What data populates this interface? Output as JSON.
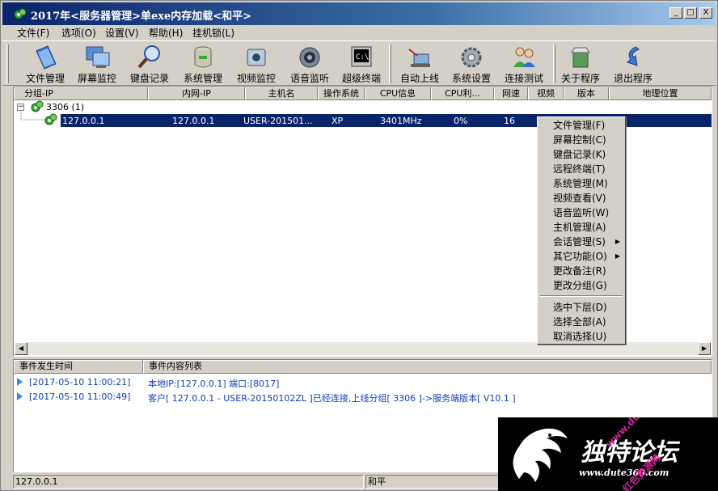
{
  "window": {
    "title": "2017年<服务器管理>单exe内存加载<和平>",
    "min_label": "_",
    "max_label": "□",
    "close_label": "X"
  },
  "menu": [
    {
      "label": "文件(F)"
    },
    {
      "label": "选项(O)"
    },
    {
      "label": "设置(V)"
    },
    {
      "label": "帮助(H)"
    },
    {
      "label": "挂机锁(L)"
    }
  ],
  "toolbar": [
    {
      "label": "文件管理",
      "icon": "file-manager-icon"
    },
    {
      "label": "屏幕监控",
      "icon": "screen-monitor-icon"
    },
    {
      "label": "键盘记录",
      "icon": "keylogger-icon"
    },
    {
      "label": "系统管理",
      "icon": "system-manager-icon"
    },
    {
      "label": "视频监控",
      "icon": "webcam-icon"
    },
    {
      "label": "语音监听",
      "icon": "speaker-icon"
    },
    {
      "label": "超级终端",
      "icon": "terminal-icon"
    },
    {
      "label": "自动上线",
      "icon": "auto-online-icon"
    },
    {
      "label": "系统设置",
      "icon": "settings-gear-icon"
    },
    {
      "label": "连接测试",
      "icon": "connection-test-icon"
    },
    {
      "label": "关于程序",
      "icon": "about-icon"
    },
    {
      "label": "退出程序",
      "icon": "exit-icon"
    }
  ],
  "grid": {
    "columns": [
      "分组-IP",
      "内网-IP",
      "主机名",
      "操作系统",
      "CPU信息",
      "CPU利...",
      "网速",
      "视频",
      "版本",
      "地理位置"
    ],
    "group": {
      "label": "3306 (1)",
      "expander": "−"
    },
    "rows": [
      {
        "ip": "127.0.0.1",
        "lan_ip": "127.0.0.1",
        "host": "USER-201501...",
        "os": "XP",
        "cpu": "3401MHz",
        "cpu_usage": "0%",
        "speed": "16"
      }
    ]
  },
  "context_menu": [
    {
      "label": "文件管理(F)"
    },
    {
      "label": "屏幕控制(C)"
    },
    {
      "label": "键盘记录(K)"
    },
    {
      "label": "远程终端(T)"
    },
    {
      "label": "系统管理(M)"
    },
    {
      "label": "视频查看(V)"
    },
    {
      "label": "语音监听(W)"
    },
    {
      "label": "主机管理(A)"
    },
    {
      "label": "会话管理(S)",
      "submenu": "▶"
    },
    {
      "label": "其它功能(O)",
      "submenu": "▶"
    },
    {
      "label": "更改备注(R)"
    },
    {
      "label": "更改分组(G)"
    },
    {
      "label": "选中下层(D)"
    },
    {
      "label": "选择全部(A)"
    },
    {
      "label": "取消选择(U)"
    }
  ],
  "log": {
    "columns": [
      "事件发生时间",
      "事件内容列表"
    ],
    "rows": [
      {
        "time": "[2017-05-10 11:00:21]",
        "message": "本地IP:[127.0.0.1] 端口:[8017]"
      },
      {
        "time": "[2017-05-10 11:00:49]",
        "message": "客户[ 127.0.0.1 - USER-20150102ZL ]已经连接,上线分组[ 3306 ]->服务端版本[ V10.1 ]"
      }
    ]
  },
  "status": {
    "left": "127.0.0.1",
    "right": "和平"
  },
  "watermark": {
    "title": "独特论坛",
    "url": "www.dute360.com",
    "diagonal_1": "www.dute360.com",
    "diagonal_2": "红色资源网"
  },
  "colors": {
    "selection": "#0a246a",
    "title_gradient_start": "#0a246a",
    "log_text": "#1040c0"
  }
}
